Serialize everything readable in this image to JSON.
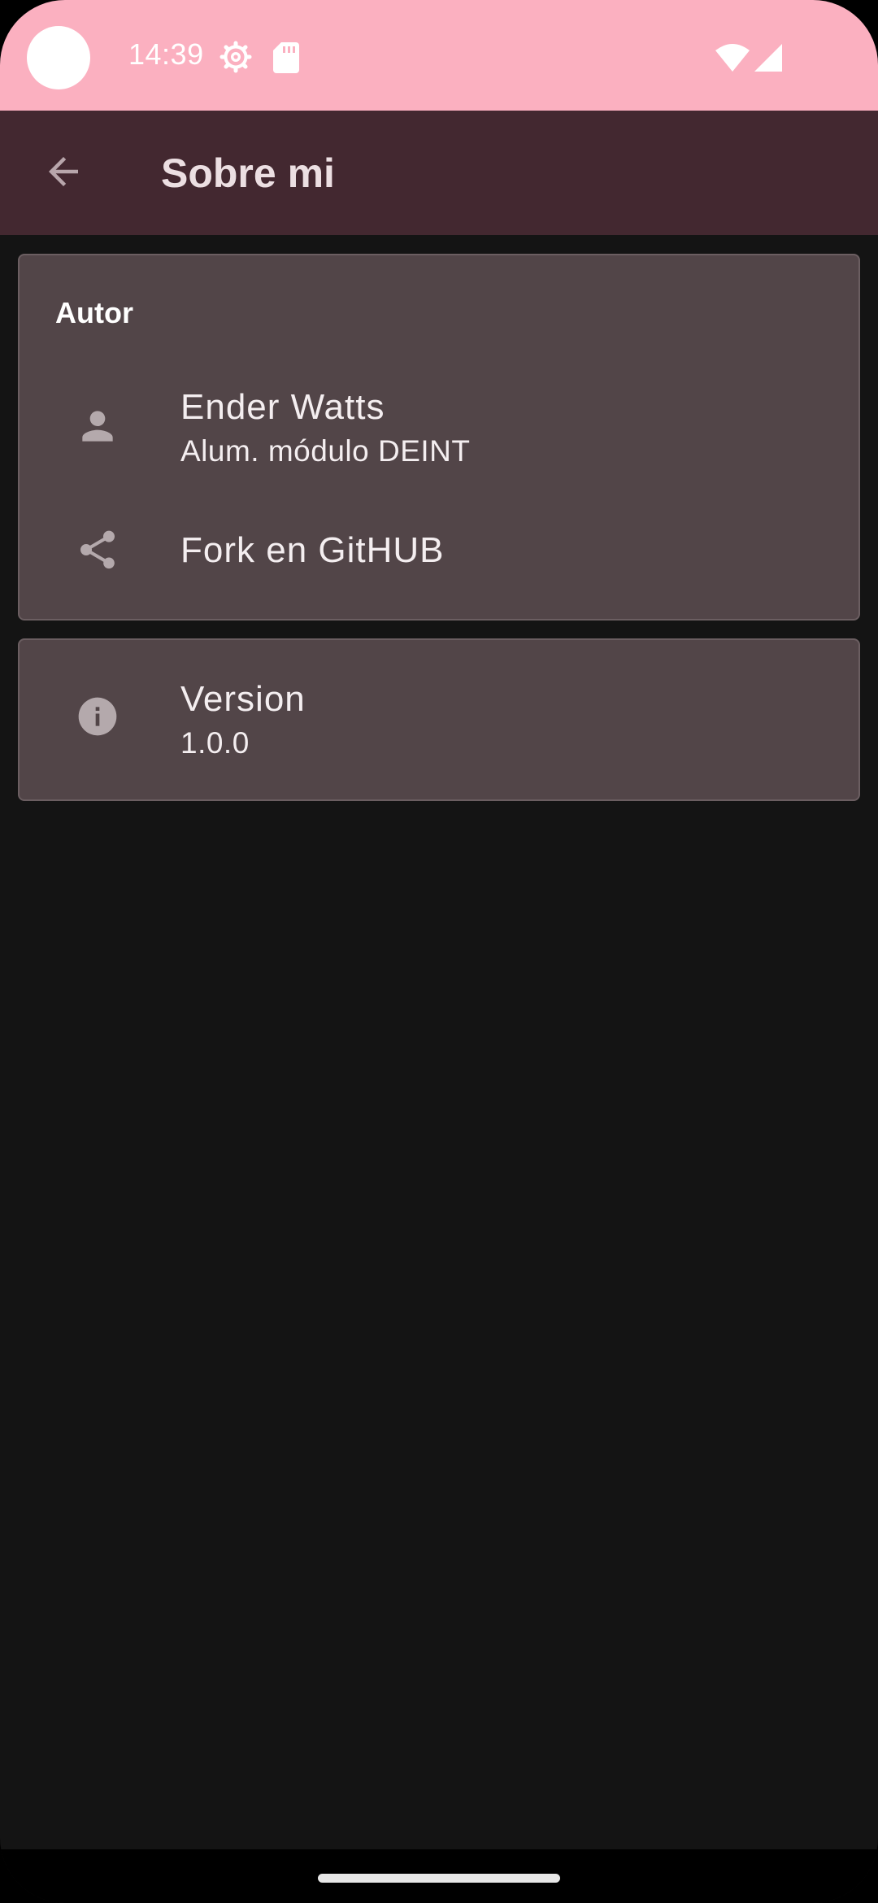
{
  "status_bar": {
    "time": "14:39",
    "icons": [
      "settings-gear-icon",
      "sd-card-icon",
      "wifi-icon",
      "cell-signal-icon"
    ]
  },
  "app_bar": {
    "back_icon": "arrow-back-icon",
    "title": "Sobre mi"
  },
  "author_card": {
    "section_title": "Autor",
    "items": [
      {
        "icon": "person-icon",
        "title": "Ender Watts",
        "subtitle": "Alum. módulo DEINT"
      },
      {
        "icon": "share-icon",
        "title": "Fork en GitHUB"
      }
    ]
  },
  "version_card": {
    "icon": "info-icon",
    "title": "Version",
    "subtitle": "1.0.0"
  },
  "colors": {
    "status_bar": "#fbb0c0",
    "app_bar": "#432830",
    "background": "#141414",
    "card": "#524548",
    "icon": "#b4a9ac"
  }
}
